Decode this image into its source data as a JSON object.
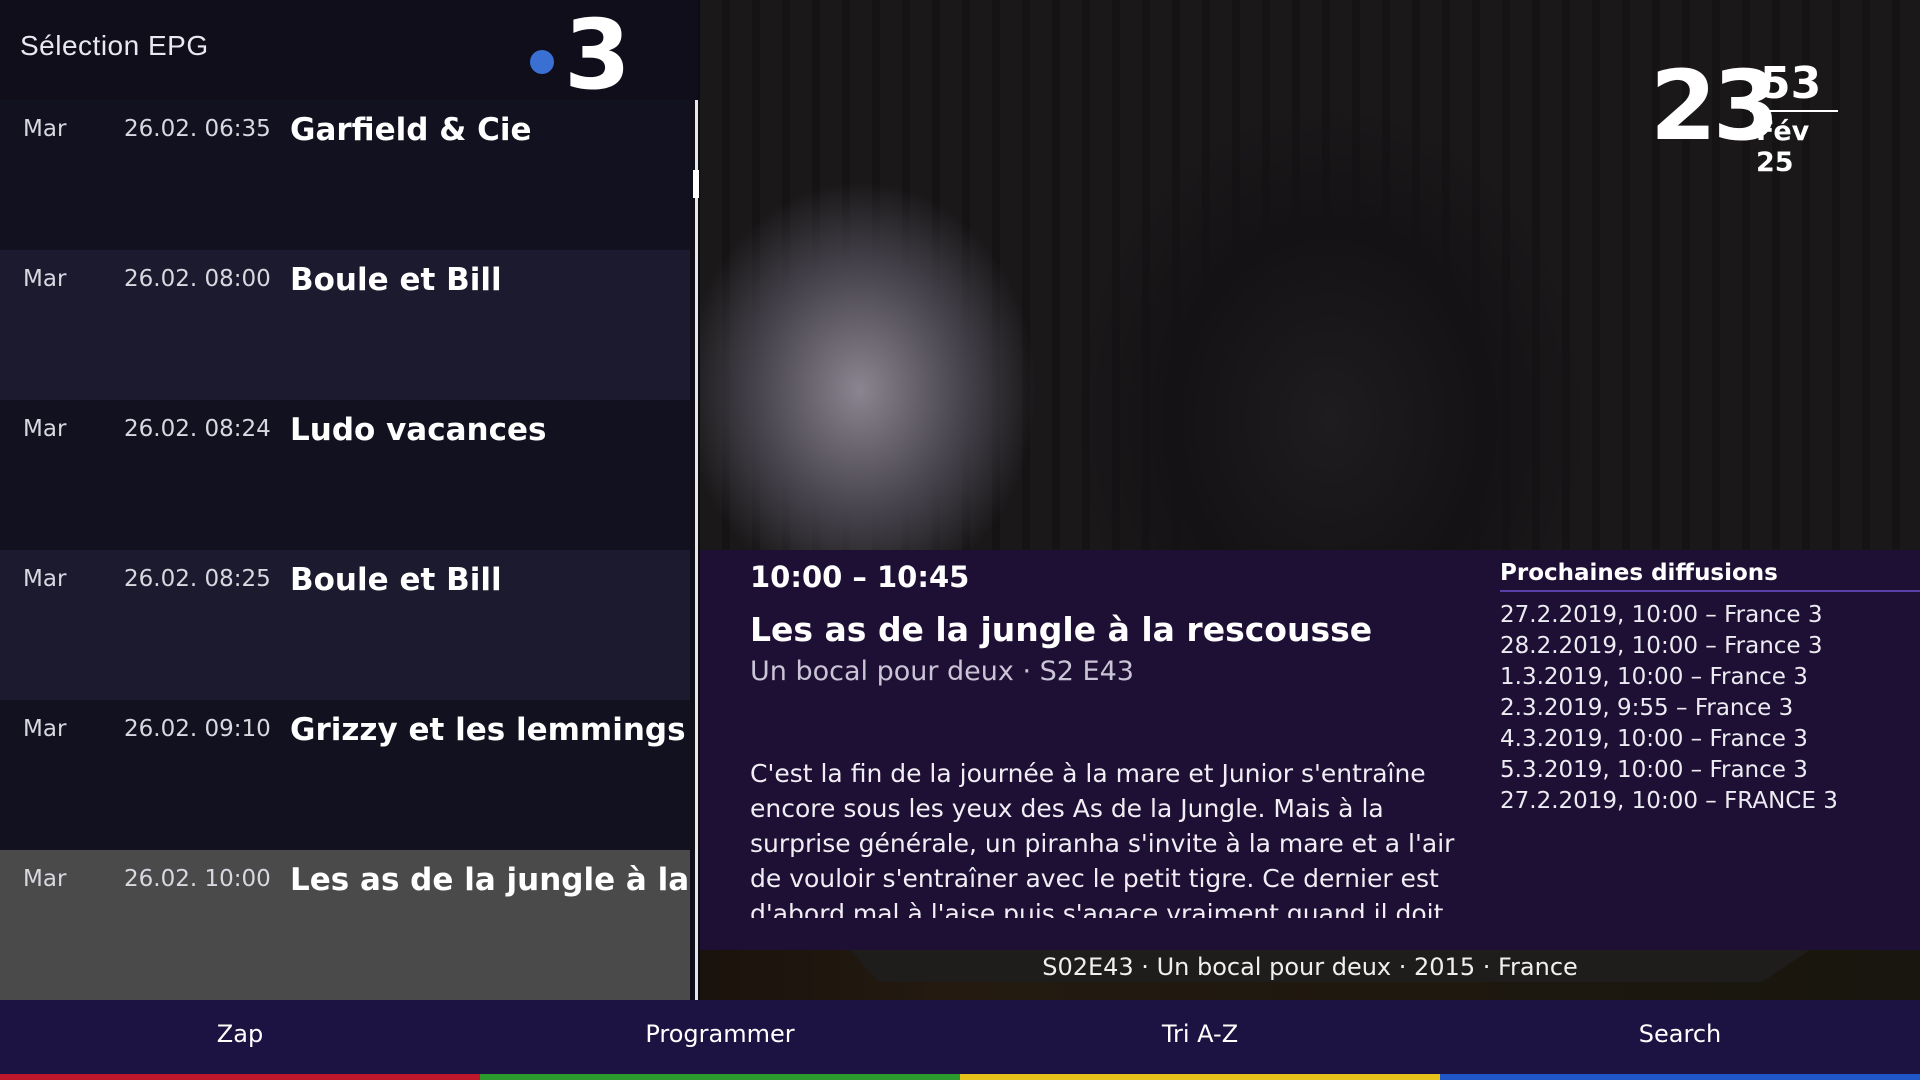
{
  "header": {
    "title": "Sélection EPG",
    "channel_logo": "France 3"
  },
  "epg": {
    "items": [
      {
        "day": "Mar",
        "date": "26.02.",
        "time": "06:35",
        "title": "Garfield & Cie"
      },
      {
        "day": "Mar",
        "date": "26.02.",
        "time": "08:00",
        "title": "Boule et Bill"
      },
      {
        "day": "Mar",
        "date": "26.02.",
        "time": "08:24",
        "title": "Ludo vacances"
      },
      {
        "day": "Mar",
        "date": "26.02.",
        "time": "08:25",
        "title": "Boule et Bill"
      },
      {
        "day": "Mar",
        "date": "26.02.",
        "time": "09:10",
        "title": "Grizzy et les lemmings"
      },
      {
        "day": "Mar",
        "date": "26.02.",
        "time": "10:00",
        "title": "Les as de la jungle à la rescousse"
      }
    ]
  },
  "clock": {
    "hour": "23",
    "minute": "53",
    "date": "Fév 25"
  },
  "details": {
    "time_range": "10:00 – 10:45",
    "title": "Les as de la jungle à la rescousse",
    "episode": "Un bocal pour deux · S2 E43",
    "synopsis": "C'est la fin de la journée à la mare et Junior s'entraîne encore sous les yeux des As de la Jungle. Mais à la surprise générale, un piranha s'invite à la mare et a l'air de vouloir s'entraîner avec le petit tigre. Ce dernier est d'abord mal à l'aise puis s'agace vraiment quand il doit partager son bocal avec le piranha, sous le regard bienveillant"
  },
  "upcoming": {
    "title": "Prochaines diffusions",
    "items": [
      "27.2.2019, 10:00 – France 3",
      "28.2.2019, 10:00 – France 3",
      "1.3.2019, 10:00 – France 3",
      "2.3.2019,  9:55 – France 3",
      "4.3.2019, 10:00 – France 3",
      "5.3.2019, 10:00 – France 3",
      "27.2.2019, 10:00 – FRANCE 3"
    ]
  },
  "meta": {
    "text": "S02E43 · Un bocal pour deux · 2015 · France"
  },
  "actions": [
    {
      "label": "Zap",
      "color": "#c0172c"
    },
    {
      "label": "Programmer",
      "color": "#2c9a2e"
    },
    {
      "label": "Tri A-Z",
      "color": "#e6c21a"
    },
    {
      "label": "Search",
      "color": "#1f56c8"
    }
  ],
  "colors": {
    "logo_dot": "#3a6fd4",
    "info_bg": "#1e1034",
    "bottom_bar": "#1d1342"
  }
}
